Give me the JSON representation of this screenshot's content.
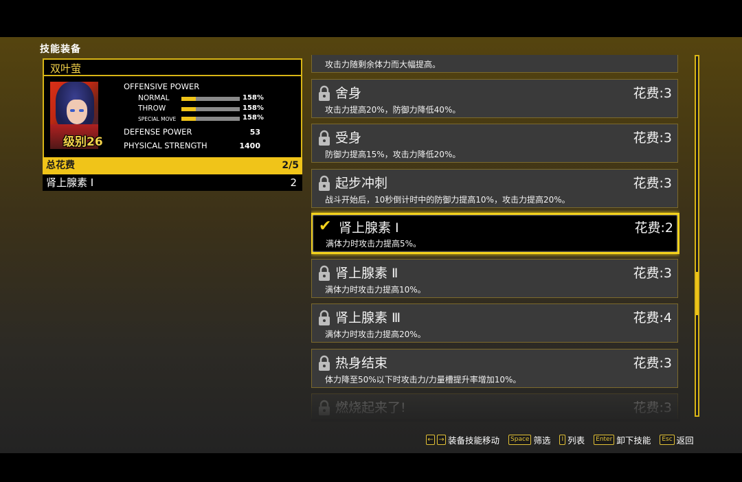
{
  "screen_title": "技能装备",
  "character": {
    "name": "双叶萤",
    "level": "级别26",
    "offensive_power_label": "OFFENSIVE POWER",
    "normal_label": "NORMAL",
    "normal_value": "158%",
    "normal_fill": 0.25,
    "throw_label": "THROW",
    "throw_value": "158%",
    "throw_fill": 0.25,
    "special_label": "SPECIAL MOVE",
    "special_value": "158%",
    "special_fill": 0.25,
    "defense_label": "DEFENSE POWER",
    "defense_value": "53",
    "strength_label": "PHYSICAL STRENGTH",
    "strength_value": "1400"
  },
  "total_cost": {
    "label": "总花费",
    "value": "2/5"
  },
  "equipped": {
    "name": "肾上腺素 Ⅰ",
    "cost": "2"
  },
  "skills": [
    {
      "name": "",
      "cost": "",
      "desc": "攻击力随剩余体力而大幅提高。",
      "locked": true,
      "selected": false
    },
    {
      "name": "舍身",
      "cost": "花费:3",
      "desc": "攻击力提高20%，防御力降低40%。",
      "locked": true,
      "selected": false
    },
    {
      "name": "受身",
      "cost": "花费:3",
      "desc": "防御力提高15%，攻击力降低20%。",
      "locked": true,
      "selected": false
    },
    {
      "name": "起步冲刺",
      "cost": "花费:3",
      "desc": "战斗开始后，10秒倒计时中的防御力提高10%，攻击力提高20%。",
      "locked": true,
      "selected": false
    },
    {
      "name": "肾上腺素 Ⅰ",
      "cost": "花费:2",
      "desc": "满体力时攻击力提高5%。",
      "locked": false,
      "selected": true
    },
    {
      "name": "肾上腺素 Ⅱ",
      "cost": "花费:3",
      "desc": "满体力时攻击力提高10%。",
      "locked": true,
      "selected": false
    },
    {
      "name": "肾上腺素 Ⅲ",
      "cost": "花费:4",
      "desc": "满体力时攻击力提高20%。",
      "locked": true,
      "selected": false
    },
    {
      "name": "热身结束",
      "cost": "花费:3",
      "desc": "体力降至50%以下时攻击力/力量槽提升率增加10%。",
      "locked": true,
      "selected": false
    },
    {
      "name": "燃烧起来了!",
      "cost": "花费:3",
      "desc": "",
      "locked": true,
      "selected": false
    }
  ],
  "scroll": {
    "position": 0.6,
    "size": 0.12
  },
  "footer": {
    "move_keys": [
      "←",
      "→"
    ],
    "move_label": "装备技能移动",
    "filter_key": "Space",
    "filter_label": "筛选",
    "list_key": "I",
    "list_label": "列表",
    "unequip_key": "Enter",
    "unequip_label": "卸下技能",
    "back_key": "Esc",
    "back_label": "返回"
  },
  "colors": {
    "accent": "#f0c419",
    "panel_border": "#d8b516",
    "bg_dark": "#232323"
  }
}
